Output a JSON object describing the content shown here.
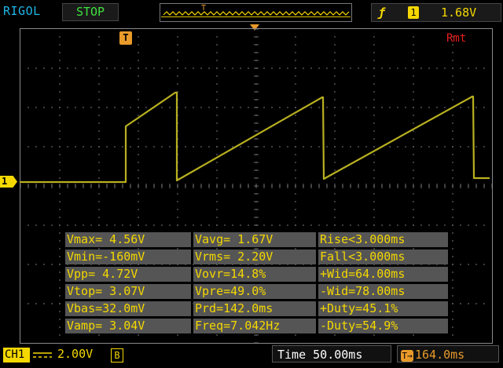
{
  "header": {
    "brand": "RIGOL",
    "run_status": "STOP",
    "trigger_marker": "T",
    "trigger_source": "1",
    "trigger_level": "1.68V",
    "edge_icon": "rising-edge-icon"
  },
  "screen": {
    "remote_indicator": "Rmt",
    "trigger_position_label": "T",
    "ch1_marker_label": "1"
  },
  "measurements": [
    [
      "Vmax= 4.56V",
      "Vavg= 1.67V",
      "Rise<3.000ms"
    ],
    [
      "Vmin=-160mV",
      "Vrms= 2.20V",
      "Fall<3.000ms"
    ],
    [
      "Vpp= 4.72V",
      "Vovr=14.8%",
      "+Wid=64.00ms"
    ],
    [
      "Vtop= 3.07V",
      "Vpre=49.0%",
      "-Wid=78.00ms"
    ],
    [
      "Vbas=32.0mV",
      "Prd=142.0ms",
      "+Duty=45.1%"
    ],
    [
      "Vamp= 3.04V",
      "Freq=7.042Hz",
      "-Duty=54.9%"
    ]
  ],
  "footer": {
    "channel": "CH1",
    "coupling_icon": "dc-coupling-icon",
    "scale": "2.00V",
    "bw_limit": "B",
    "timebase": "Time 50.00ms",
    "trigger_offset": "164.0ms"
  },
  "colors": {
    "ch1": "#f5d800",
    "trace": "#b8b020",
    "trigger": "#e89a2a",
    "grid": "#8a8a8a",
    "brand": "#1fb5e8",
    "stop": "#3fe23f",
    "remote": "#e81e1e"
  }
}
